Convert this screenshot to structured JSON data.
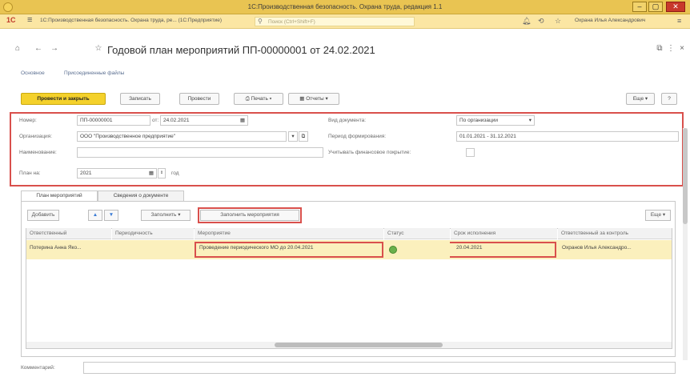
{
  "window": {
    "title": "1С:Производственная безопасность. Охрана труда, редакция 1.1"
  },
  "topbar": {
    "logo": "1С",
    "breadcrumb": "1С:Производственная безопасность. Охрана труда, ре... (1С:Предприятие)",
    "search_placeholder": "Поиск (Ctrl+Shift+F)",
    "user": "Охрана Илья Александрович"
  },
  "document": {
    "title": "Годовой план мероприятий ПП-00000001 от 24.02.2021",
    "links": [
      "Основное",
      "Присоединенные файлы"
    ]
  },
  "commandbar": {
    "post_close": "Провести и закрыть",
    "save": "Записать",
    "post": "Провести",
    "print": "Печать",
    "reports": "Отчеты",
    "more": "Еще",
    "help": "?"
  },
  "form": {
    "number_label": "Номер:",
    "number_value": "ПП-00000001",
    "from_label": "от:",
    "date_value": "24.02.2021",
    "org_label": "Организация:",
    "org_value": "ООО \"Производственное предприятие\"",
    "name_label": "Наименование:",
    "name_value": "",
    "year_label": "План на:",
    "year_value": "2021",
    "year_suffix": "год",
    "doctype_label": "Вид документа:",
    "doctype_value": "По организации",
    "period_label": "Период формирования:",
    "period_value": "01.01.2021 - 31.12.2021",
    "financial_label": "Учитывать финансовое покрытие:"
  },
  "tabs": [
    "План мероприятий",
    "Сведения о документе"
  ],
  "tablebar": {
    "add": "Добавить",
    "fill": "Заполнить",
    "fill_events": "Заполнить мероприятия",
    "more": "Еще"
  },
  "table": {
    "columns": [
      "Ответственный",
      "Периодичность",
      "Мероприятие",
      "Статус",
      "Срок исполнения",
      "Ответственный за контроль"
    ],
    "rows": [
      {
        "responsible": "Потерина Анна Яко...",
        "period": "",
        "event": "Проведение периодического МО до 20.04.2021",
        "status": "green",
        "due": "20.04.2021",
        "controller": "Охранов Илья Александро..."
      }
    ]
  },
  "comment": {
    "label": "Комментарий:"
  },
  "colors": {
    "accent": "#f4d12b",
    "highlight": "#d9504c",
    "title_bar": "#e9c452"
  }
}
